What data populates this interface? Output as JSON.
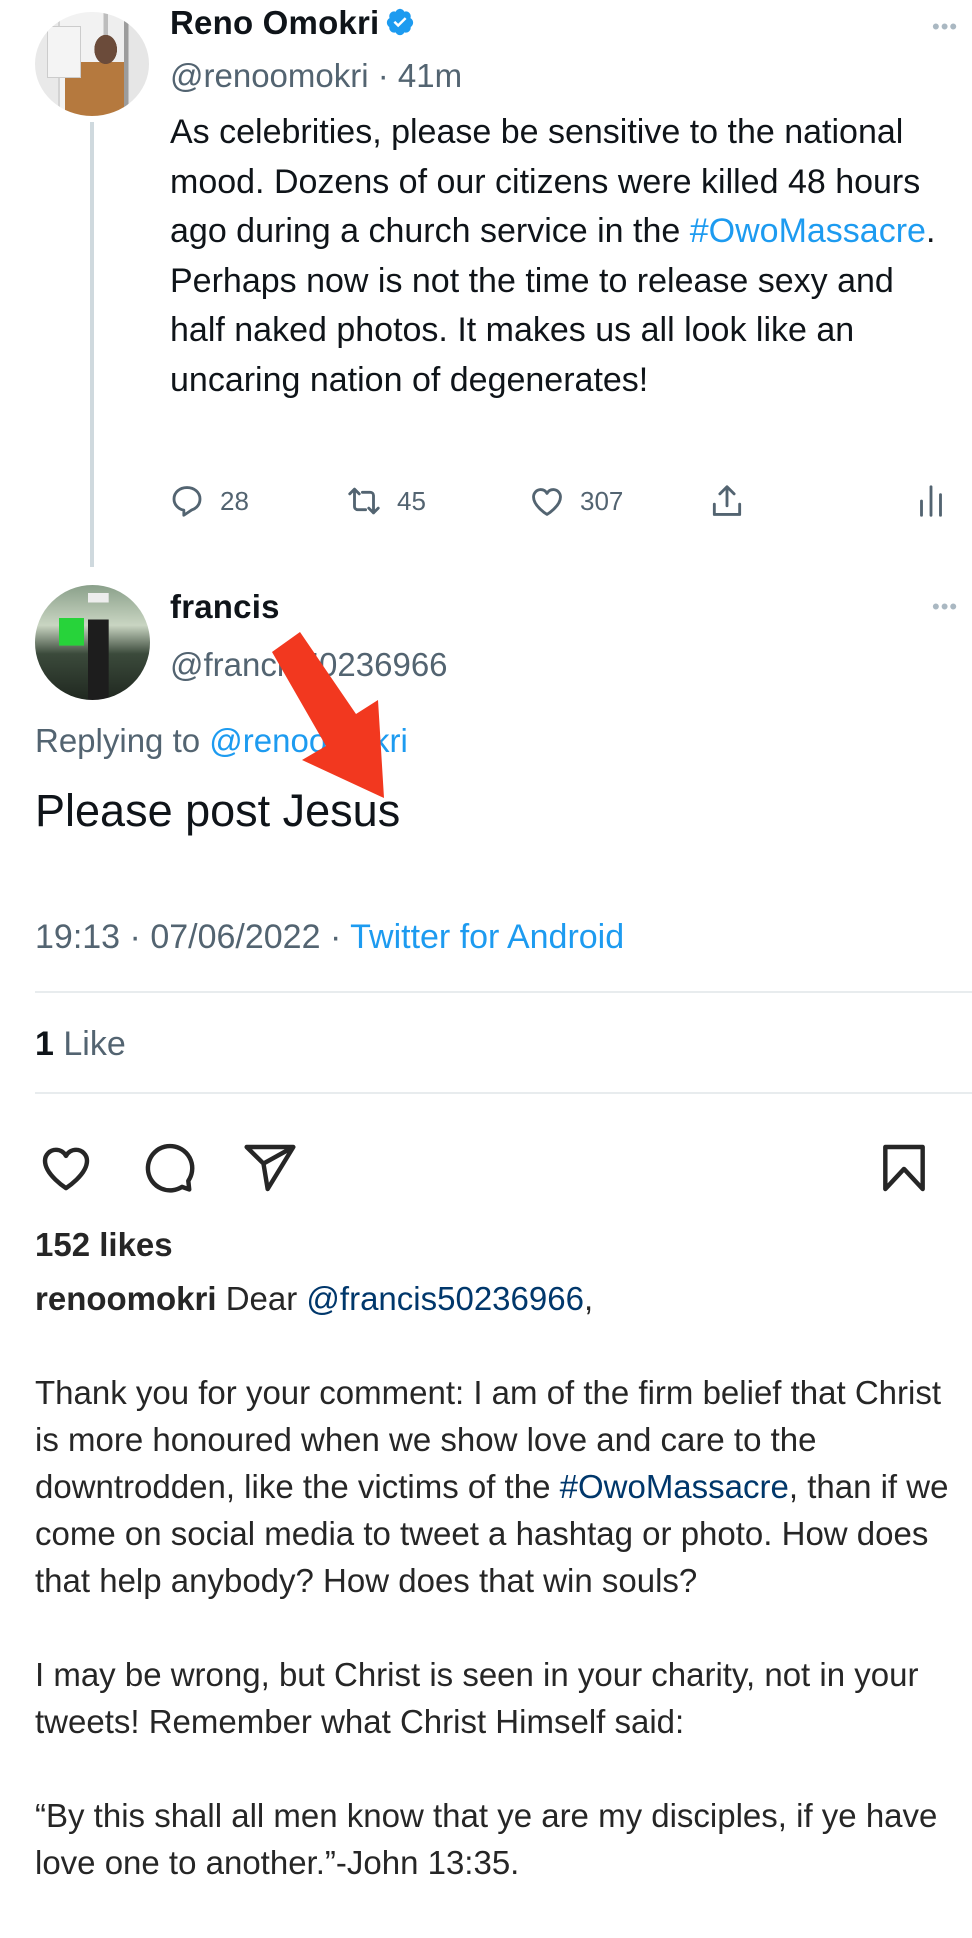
{
  "tweet": {
    "author_name": "Reno Omokri",
    "verified": true,
    "handle": "@renoomokri",
    "separator": "·",
    "time_ago": "41m",
    "more_label": "•••",
    "body_before_hashtag": "As celebrities, please be sensitive to the national mood. Dozens of our citizens were killed 48 hours ago during a church service in the ",
    "hashtag": "#OwoMassacre",
    "body_after_hashtag": ". Perhaps now is not the time to release sexy and half naked photos. It makes us all look like an uncaring nation of degenerates!",
    "actions": {
      "replies": "28",
      "retweets": "45",
      "likes": "307"
    }
  },
  "reply": {
    "author_name": "francis",
    "handle": "@francis50236966",
    "more_label": "•••",
    "replying_to_label": "Replying to",
    "replying_to_handle": "@renoomokri",
    "text": "Please post Jesus",
    "time": "19:13",
    "date": "07/06/2022",
    "separator": "·",
    "source": "Twitter for Android",
    "like_count": "1",
    "like_label": "Like"
  },
  "instagram": {
    "likes_label": "152 likes",
    "username": "renoomokri",
    "greeting": "Dear",
    "mention": "@francis50236966",
    "mention_suffix": ",",
    "paragraph1_before_hashtag": "Thank you for your comment: I am of the firm belief that Christ is more honoured when we show love and care to the downtrodden, like the victims of the ",
    "paragraph1_hashtag": "#OwoMassacre",
    "paragraph1_after_hashtag": ", than if we come on social media to tweet a hashtag or photo. How does that help anybody? How does that win souls?",
    "paragraph2": "I may be wrong, but Christ is seen in your charity, not in your tweets! Remember what Christ Himself said:",
    "paragraph3": "“By this shall all men know that ye are my disciples, if ye have love one to another.”-John 13:35."
  },
  "colors": {
    "twitter_link": "#1d9bf0",
    "twitter_secondary": "#536471",
    "instagram_link": "#00376b",
    "annotation_arrow": "#f2381f",
    "verified_badge": "#1d9bf0"
  }
}
